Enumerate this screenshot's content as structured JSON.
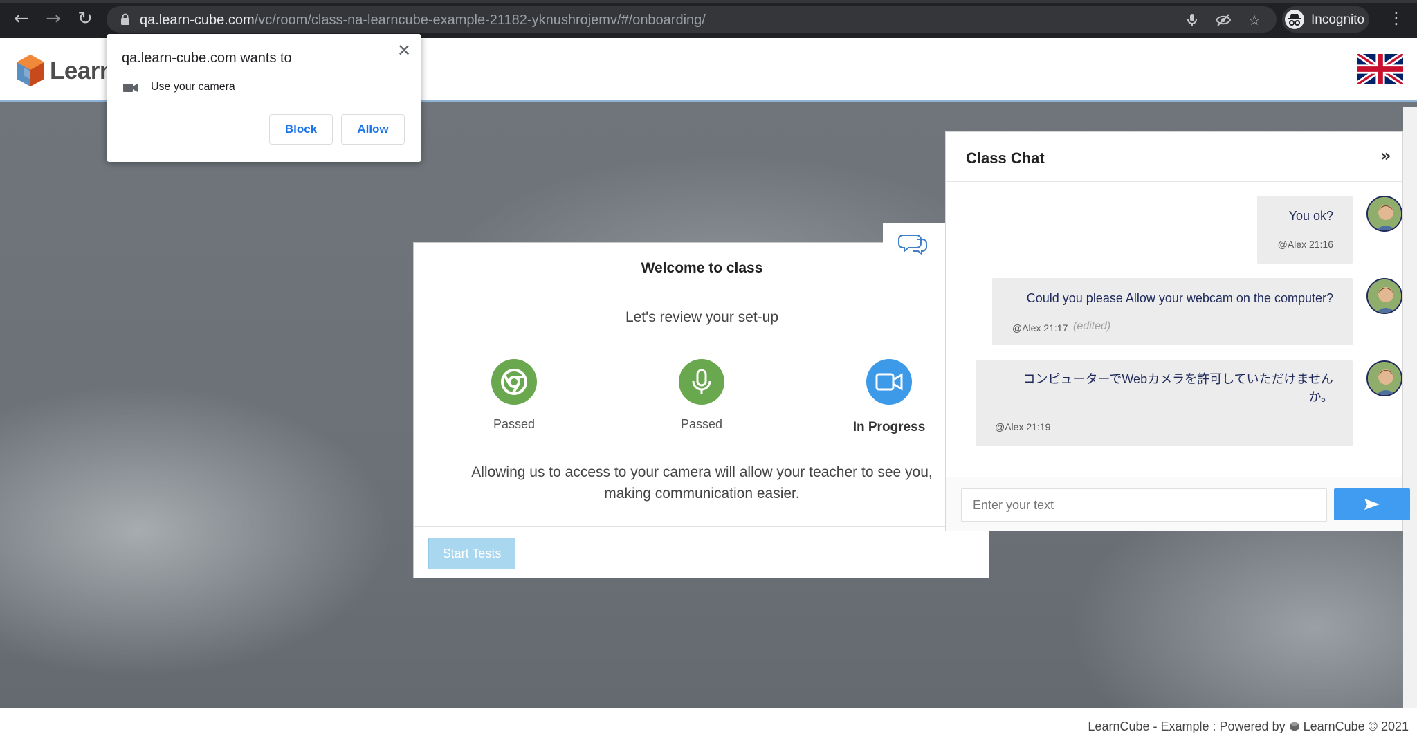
{
  "browser": {
    "url_host": "qa.learn-cube.com",
    "url_path": "/vc/room/class-na-learncube-example-21182-yknushrojemv/#/onboarding/",
    "profile_label": "Incognito"
  },
  "app": {
    "logo_text": "Learn"
  },
  "permission": {
    "title": "qa.learn-cube.com wants to",
    "request": "Use your camera",
    "block_label": "Block",
    "allow_label": "Allow"
  },
  "welcome": {
    "title": "Welcome to class",
    "subtitle": "Let's review your set-up",
    "steps": [
      {
        "status": "Passed",
        "icon": "chrome-icon",
        "color": "#6aa84f"
      },
      {
        "status": "Passed",
        "icon": "microphone-icon",
        "color": "#6aa84f"
      },
      {
        "status": "In Progress",
        "icon": "video-camera-icon",
        "color": "#3d9ae8"
      }
    ],
    "description_line1": "Allowing us to access to your camera will allow your teacher to see you,",
    "description_line2": "making communication easier.",
    "start_label": "Start Tests"
  },
  "chat": {
    "title": "Class Chat",
    "messages": [
      {
        "text": "You ok?",
        "meta": "@Alex 21:16",
        "edited": ""
      },
      {
        "text": "Could you please Allow your webcam on the computer?",
        "meta": "@Alex 21:17",
        "edited": "(edited)"
      },
      {
        "text_line1": "コンピューターでWebカメラを許可していただけません",
        "text_line2": "か。",
        "meta": "@Alex 21:19",
        "edited": ""
      }
    ],
    "input_placeholder": "Enter your text"
  },
  "footer": {
    "prefix": "LearnCube - Example : Powered by",
    "brand": "LearnCube © 2021"
  },
  "colors": {
    "accent": "#3f9cf0",
    "passed": "#6aa84f",
    "in_progress": "#3d9ae8"
  }
}
